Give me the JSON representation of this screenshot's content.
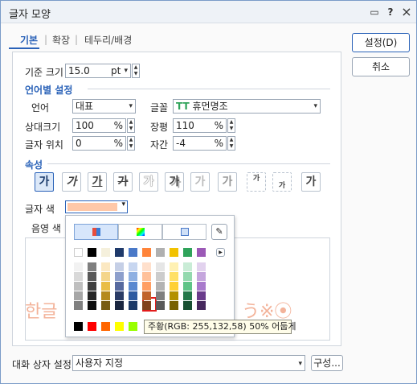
{
  "window": {
    "title": "글자 모양"
  },
  "titlebar": {
    "icon1": "chat-icon",
    "help_label": "?",
    "close_label": "×"
  },
  "tabs": [
    {
      "label": "기본"
    },
    {
      "label": "확장"
    },
    {
      "label": "테두리/배경"
    }
  ],
  "buttons": {
    "ok": "설정(D)",
    "cancel": "취소",
    "config": "구성..."
  },
  "base_size": {
    "label": "기준 크기",
    "value": "15.0",
    "unit": "pt"
  },
  "lang_section": {
    "title": "언어별 설정"
  },
  "language": {
    "label": "언어",
    "value": "대표"
  },
  "font": {
    "label": "글꼴",
    "value": "휴먼명조",
    "icon": "TT"
  },
  "rel_size": {
    "label": "상대크기",
    "value": "100",
    "unit": "%"
  },
  "width": {
    "label": "장평",
    "value": "110",
    "unit": "%"
  },
  "position": {
    "label": "글자 위치",
    "value": "0",
    "unit": "%"
  },
  "spacing": {
    "label": "자간",
    "value": "-4",
    "unit": "%"
  },
  "attr_section": {
    "title": "속성"
  },
  "attr_buttons": [
    {
      "label": "가",
      "name": "bold"
    },
    {
      "label": "가",
      "name": "italic"
    },
    {
      "label": "가",
      "name": "underline"
    },
    {
      "label": "가",
      "name": "strikeout"
    },
    {
      "label": "가",
      "name": "outline"
    },
    {
      "label": "가",
      "name": "shadow"
    },
    {
      "label": "가",
      "name": "emboss"
    },
    {
      "label": "가",
      "name": "engrave"
    },
    {
      "label": "가",
      "name": "superscript"
    },
    {
      "label": "가",
      "name": "subscript"
    },
    {
      "label": "가",
      "name": "normal"
    }
  ],
  "text_color": {
    "label": "글자 색",
    "value": "#ffc8a8"
  },
  "shade_color": {
    "label": "음영 색"
  },
  "preview": {
    "left": "한글",
    "right": "う※⦿"
  },
  "tooltip": {
    "text": "주황(RGB: 255,132,58) 50% 어둡게"
  },
  "dialog_settings": {
    "label": "대화 상자 설정",
    "value": "사용자 지정"
  },
  "palette": {
    "top_row": [
      "#ffffff",
      "#000000",
      "#f5f0dc",
      "#1f3a6b",
      "#4a79c8",
      "#ff843a",
      "#b0b0b0",
      "#f2c200",
      "#2fa35a",
      "#9b59b6"
    ],
    "grid": [
      [
        "#f2f2f2",
        "#7f7f7f",
        "#fbe8c2",
        "#c5cfe6",
        "#c7d6f0",
        "#ffe0cc",
        "#e6e6e6",
        "#fff1b3",
        "#c9ecd6",
        "#e2d2ee"
      ],
      [
        "#d9d9d9",
        "#595959",
        "#f4d58a",
        "#8d9fcc",
        "#8fb0e2",
        "#ffc19a",
        "#cccccc",
        "#ffe066",
        "#93d9ae",
        "#c5a6dd"
      ],
      [
        "#bfbfbf",
        "#3f3f3f",
        "#e9bd45",
        "#56699f",
        "#5a88d0",
        "#ff9e63",
        "#b3b3b3",
        "#ffd033",
        "#5ec487",
        "#a87acc"
      ],
      [
        "#a6a6a6",
        "#262626",
        "#b58a1d",
        "#2a3c66",
        "#2e5aa0",
        "#c0632b",
        "#7f7f7f",
        "#b39100",
        "#23784a",
        "#6a3c8c"
      ],
      [
        "#808080",
        "#0d0d0d",
        "#785c13",
        "#1a2640",
        "#1d3a68",
        "#80421d",
        "#595959",
        "#776000",
        "#175031",
        "#46285d"
      ]
    ],
    "std_row": [
      "#000000",
      "#ff0000",
      "#ff6600",
      "#ffff00",
      "#99ff00"
    ]
  },
  "colors": {
    "accent": "#2a62b8",
    "preview": "#f3b39a"
  }
}
